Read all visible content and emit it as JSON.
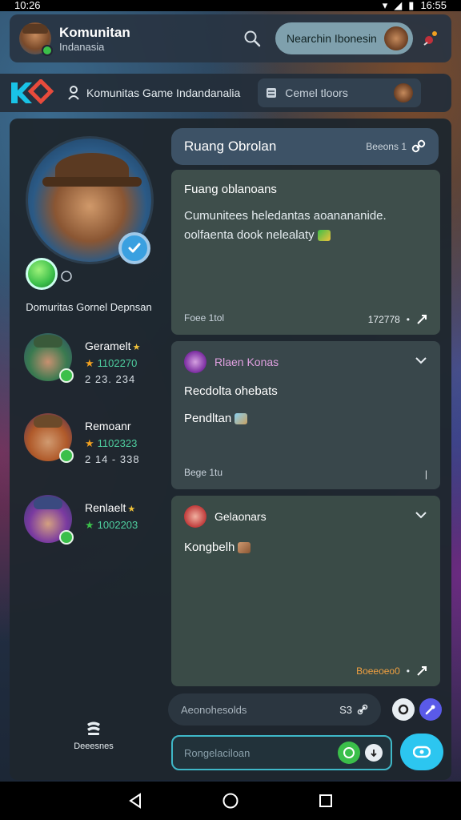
{
  "status_bar": {
    "time_left": "10:26",
    "time_right": "16:55"
  },
  "header": {
    "title": "Komunitan",
    "subtitle": "Indanasia",
    "search_icon": "search-icon",
    "pill_label": "Nearchin Ibonesin",
    "bell_icon": "notification-bell-icon"
  },
  "subbar": {
    "logo_icon": "ko-logo-icon",
    "title": "Komunitas Game Indandanalia",
    "chip_label": "Cemel tloors"
  },
  "profile": {
    "name": "Domuritas Gornel Depnsan"
  },
  "members": [
    {
      "name": "Geramelt",
      "score": "1102270",
      "meta": "2  23.  234"
    },
    {
      "name": "Remoanr",
      "score": "1102323",
      "meta": "2  14 - 338"
    },
    {
      "name": "Renlaelt",
      "score": "1002203",
      "meta": ""
    }
  ],
  "sidebar_footer": {
    "label": "Deeesnes",
    "icon": "stack-icon"
  },
  "room": {
    "title": "Ruang Obrolan",
    "meta": "Beeons  1"
  },
  "posts": [
    {
      "title": "Fuang oblanoans",
      "body": "Cumunitees heledantas aoanananide. oolfaenta dook nelealaty",
      "footer_left": "Foee 1tol",
      "footer_right": "172778"
    },
    {
      "author": "Rlaen Konas",
      "line1": "Recdolta ohebats",
      "line2": "Pendltan",
      "footer_left": "Bege 1tu"
    },
    {
      "author": "Gelaonars",
      "line1": "Kongbelh",
      "footer_right": "Boeeoeo0"
    }
  ],
  "input_bar": {
    "placeholder": "Aeonohesolds",
    "count": "S3"
  },
  "compose": {
    "placeholder": "Rongelaciloan"
  },
  "colors": {
    "accent": "#2cc6f0",
    "online": "#3bbf4a",
    "panel": "#1e262e"
  }
}
